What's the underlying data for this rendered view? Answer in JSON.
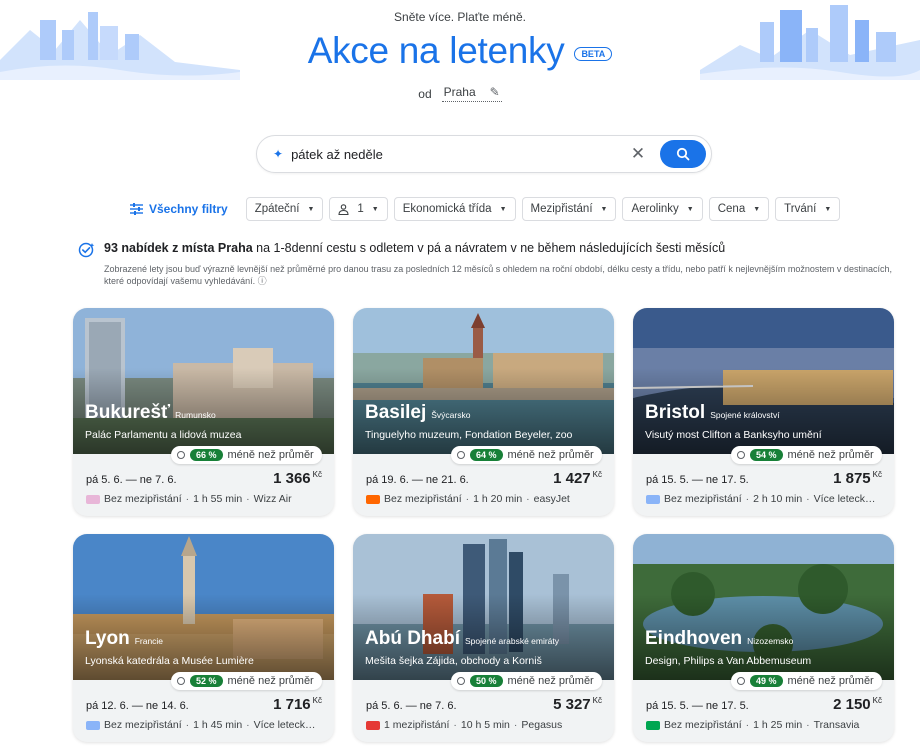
{
  "hero": {
    "tagline": "Sněte více. Plaťte méně.",
    "title": "Akce na letenky",
    "beta_label": "BETA",
    "from_label": "od",
    "origin": "Praha"
  },
  "search": {
    "query": "pátek až neděle"
  },
  "filters": {
    "all_filters": "Všechny filtry",
    "trip_type": "Zpáteční",
    "passengers": "1",
    "cabin": "Ekonomická třída",
    "stops": "Mezipřistání",
    "airlines": "Aerolinky",
    "price": "Cena",
    "duration": "Trvání"
  },
  "results": {
    "title_bold": "93 nabídek z místa Praha",
    "title_rest": " na 1-8denní cestu s odletem v pá a návratem v ne během následujících šesti měsíců",
    "subtitle": "Zobrazené lety jsou buď výrazně levnější než průměrné pro danou trasu za posledních 12 měsíců s ohledem na roční období, délku cesty a třídu, nebo patří k nejlevnějším možnostem v destinacích, které odpovídají vašemu vyhledávání.",
    "info_icon": "ⓘ"
  },
  "deals": [
    {
      "city": "Bukurešť",
      "country": "Rumunsko",
      "sights": "Palác Parlamentu a lidová muzea",
      "percent": "66 %",
      "below_label": "méně než průměr",
      "dates": "pá 5. 6. — ne 7. 6.",
      "price": "1 366",
      "currency": "Kč",
      "stops": "Bez mezipřistání",
      "duration": "1 h 55 min",
      "airline": "Wizz Air",
      "logo_color": "#e8b6d8"
    },
    {
      "city": "Basilej",
      "country": "Švýcarsko",
      "sights": "Tinguelyho muzeum, Fondation Beyeler, zoo",
      "percent": "64 %",
      "below_label": "méně než průměr",
      "dates": "pá 19. 6. — ne 21. 6.",
      "price": "1 427",
      "currency": "Kč",
      "stops": "Bez mezipřistání",
      "duration": "1 h 20 min",
      "airline": "easyJet",
      "logo_color": "#ff6600"
    },
    {
      "city": "Bristol",
      "country": "Spojené království",
      "sights": "Visutý most Clifton a Banksyho umění",
      "percent": "54 %",
      "below_label": "méně než průměr",
      "dates": "pá 15. 5. — ne 17. 5.",
      "price": "1 875",
      "currency": "Kč",
      "stops": "Bez mezipřistání",
      "duration": "2 h 10 min",
      "airline": "Více leteck…",
      "logo_color": "#8ab4f8"
    },
    {
      "city": "Lyon",
      "country": "Francie",
      "sights": "Lyonská katedrála a Musée Lumière",
      "percent": "52 %",
      "below_label": "méně než průměr",
      "dates": "pá 12. 6. — ne 14. 6.",
      "price": "1 716",
      "currency": "Kč",
      "stops": "Bez mezipřistání",
      "duration": "1 h 45 min",
      "airline": "Více leteck…",
      "logo_color": "#8ab4f8"
    },
    {
      "city": "Abú Dhabí",
      "country": "Spojené arabské emiráty",
      "sights": "Mešita šejka Zájida, obchody a Korniš",
      "percent": "50 %",
      "below_label": "méně než průměr",
      "dates": "pá 5. 6. — ne 7. 6.",
      "price": "5 327",
      "currency": "Kč",
      "stops": "1 mezipřistání",
      "duration": "10 h 5 min",
      "airline": "Pegasus",
      "logo_color": "#e53935"
    },
    {
      "city": "Eindhoven",
      "country": "Nizozemsko",
      "sights": "Design, Philips a Van Abbemuseum",
      "percent": "49 %",
      "below_label": "méně než průměr",
      "dates": "pá 15. 5. — ne 17. 5.",
      "price": "2 150",
      "currency": "Kč",
      "stops": "Bez mezipřistání",
      "duration": "1 h 25 min",
      "airline": "Transavia",
      "logo_color": "#00a651"
    }
  ],
  "colors": {
    "accent": "#1a73e8",
    "discount_badge": "#188038"
  }
}
